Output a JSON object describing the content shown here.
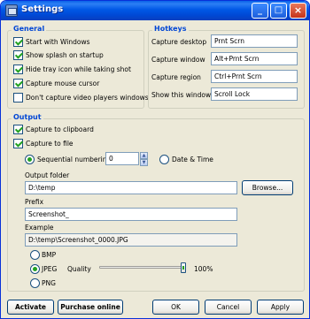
{
  "window": {
    "title": "Settings"
  },
  "general": {
    "title": "General",
    "options": [
      {
        "label": "Start with Windows",
        "checked": true
      },
      {
        "label": "Show splash on startup",
        "checked": true
      },
      {
        "label": "Hide tray icon while taking shot",
        "checked": true
      },
      {
        "label": "Capture mouse cursor",
        "checked": true
      },
      {
        "label": "Don't capture video players windows",
        "checked": false
      }
    ]
  },
  "hotkeys": {
    "title": "Hotkeys",
    "rows": [
      {
        "label": "Capture desktop",
        "value": "Prnt Scrn"
      },
      {
        "label": "Capture window",
        "value": "Alt+Prnt Scrn"
      },
      {
        "label": "Capture region",
        "value": "Ctrl+Prnt Scrn"
      },
      {
        "label": "Show this window",
        "value": "Scroll Lock"
      }
    ]
  },
  "output": {
    "title": "Output",
    "capture_clipboard": {
      "label": "Capture to clipboard",
      "checked": true
    },
    "capture_file": {
      "label": "Capture to file",
      "checked": true
    },
    "sequential": {
      "label": "Sequential numbering",
      "selected": true,
      "value": "0"
    },
    "datetime": {
      "label": "Date & Time",
      "selected": false
    },
    "folder": {
      "label": "Output folder",
      "value": "D:\\temp",
      "browse": "Browse..."
    },
    "prefix": {
      "label": "Prefix",
      "value": "Screenshot_"
    },
    "example": {
      "label": "Example",
      "value": "D:\\temp\\Screenshot_0000.JPG"
    },
    "formats": {
      "bmp": "BMP",
      "jpeg": "JPEG",
      "png": "PNG",
      "selected": "JPEG"
    },
    "quality": {
      "label": "Quality",
      "value": "100%",
      "level": 1.0
    }
  },
  "buttons": {
    "activate": "Activate",
    "purchase": "Purchase online",
    "ok": "OK",
    "cancel": "Cancel",
    "apply": "Apply"
  }
}
